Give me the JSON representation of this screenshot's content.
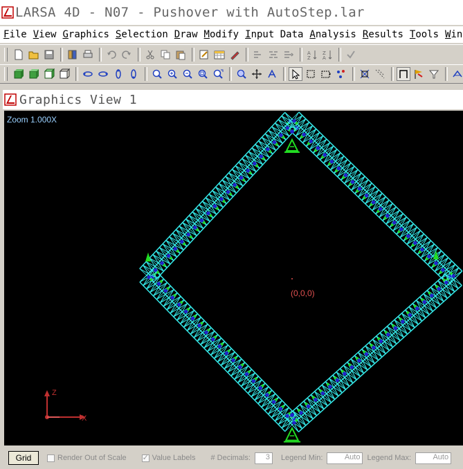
{
  "window": {
    "title": "LARSA 4D - N07 - Pushover with AutoStep.lar"
  },
  "menubar": {
    "items": [
      "File",
      "View",
      "Graphics",
      "Selection",
      "Draw",
      "Modify",
      "Input Data",
      "Analysis",
      "Results",
      "Tools",
      "Window"
    ]
  },
  "toolbar1": {
    "icons": [
      "new-file-icon",
      "open-folder-icon",
      "save-icon",
      "properties-icon",
      "print-icon",
      "undo-icon",
      "redo-icon",
      "cut-icon",
      "copy-icon",
      "paste-icon",
      "edit-icon",
      "spreadsheet-icon",
      "pencil-icon",
      "align-left-icon",
      "align-center-icon",
      "align-right-icon",
      "sort-asc-icon",
      "sort-desc-icon",
      "check-icon"
    ]
  },
  "toolbar2": {
    "icons": [
      "solid-view-icon",
      "shaded-view-icon",
      "box-view-icon",
      "wire-view-icon",
      "rotate-left-icon",
      "rotate-right-icon",
      "rotate-up-icon",
      "rotate-down-icon",
      "zoom-fit-icon",
      "zoom-in-icon",
      "zoom-out-icon",
      "zoom-window-icon",
      "zoom-previous-icon",
      "zoom-box-icon",
      "pan-icon",
      "orbit-icon",
      "select-pointer-icon",
      "select-box-icon",
      "select-window-icon",
      "select-nodes-icon",
      "snap-icon",
      "grid-snap-icon",
      "frame-view-icon",
      "color-flag-icon",
      "filter-icon",
      "axis-icon"
    ]
  },
  "graphics_view": {
    "title": "Graphics View 1",
    "zoom_label": "Zoom  1.000X",
    "origin_label": "(0,0,0)",
    "axis_z": "Z",
    "axis_x": "X",
    "colors": {
      "mesh": "#35e8e8",
      "support": "#22dd22",
      "node": "#2222cc",
      "origin": "#e05050"
    }
  },
  "statusbar": {
    "grid_button": "Grid",
    "render_out_of_scale": "Render Out of Scale",
    "render_out_of_scale_checked": false,
    "value_labels": "Value Labels",
    "value_labels_checked": true,
    "decimals_label": "# Decimals:",
    "decimals_value": "3",
    "legend_min_label": "Legend Min:",
    "legend_min_value": "Auto",
    "legend_max_label": "Legend Max:",
    "legend_max_value": "Auto"
  }
}
